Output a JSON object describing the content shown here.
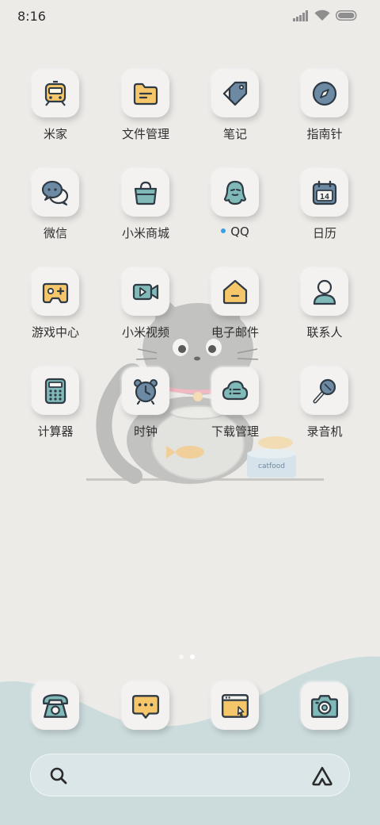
{
  "status_bar": {
    "time": "8:16",
    "icons": [
      "signal-icon",
      "wifi-icon",
      "battery-icon"
    ]
  },
  "colors": {
    "yellow": "#f5c76a",
    "teal": "#7fb9b8",
    "slate": "#6d8aa5",
    "outline": "#2f3a44",
    "new_dot": "#3b9de2"
  },
  "apps": [
    {
      "name": "米家",
      "icon": "home-train-icon"
    },
    {
      "name": "文件管理",
      "icon": "folder-icon"
    },
    {
      "name": "笔记",
      "icon": "tag-icon"
    },
    {
      "name": "指南针",
      "icon": "compass-icon"
    },
    {
      "name": "微信",
      "icon": "chat-bubbles-icon"
    },
    {
      "name": "小米商城",
      "icon": "shopping-bag-icon"
    },
    {
      "name": "QQ",
      "icon": "penguin-icon",
      "has_new": true
    },
    {
      "name": "日历",
      "icon": "calendar-icon",
      "calendar_text": "14"
    },
    {
      "name": "游戏中心",
      "icon": "gamepad-icon"
    },
    {
      "name": "小米视频",
      "icon": "video-camera-icon"
    },
    {
      "name": "电子邮件",
      "icon": "envelope-icon"
    },
    {
      "name": "联系人",
      "icon": "person-icon"
    },
    {
      "name": "计算器",
      "icon": "calculator-icon"
    },
    {
      "name": "时钟",
      "icon": "alarm-clock-icon"
    },
    {
      "name": "下载管理",
      "icon": "cloud-download-icon"
    },
    {
      "name": "录音机",
      "icon": "microphone-icon"
    }
  ],
  "wallpaper": {
    "can_label": "catfood"
  },
  "page_indicator": {
    "count": 2,
    "active": 1
  },
  "dock": [
    {
      "icon": "telephone-icon"
    },
    {
      "icon": "message-icon"
    },
    {
      "icon": "browser-icon"
    },
    {
      "icon": "camera-icon"
    }
  ],
  "search_bar": {
    "icons": [
      "search-icon",
      "assistant-icon"
    ]
  }
}
